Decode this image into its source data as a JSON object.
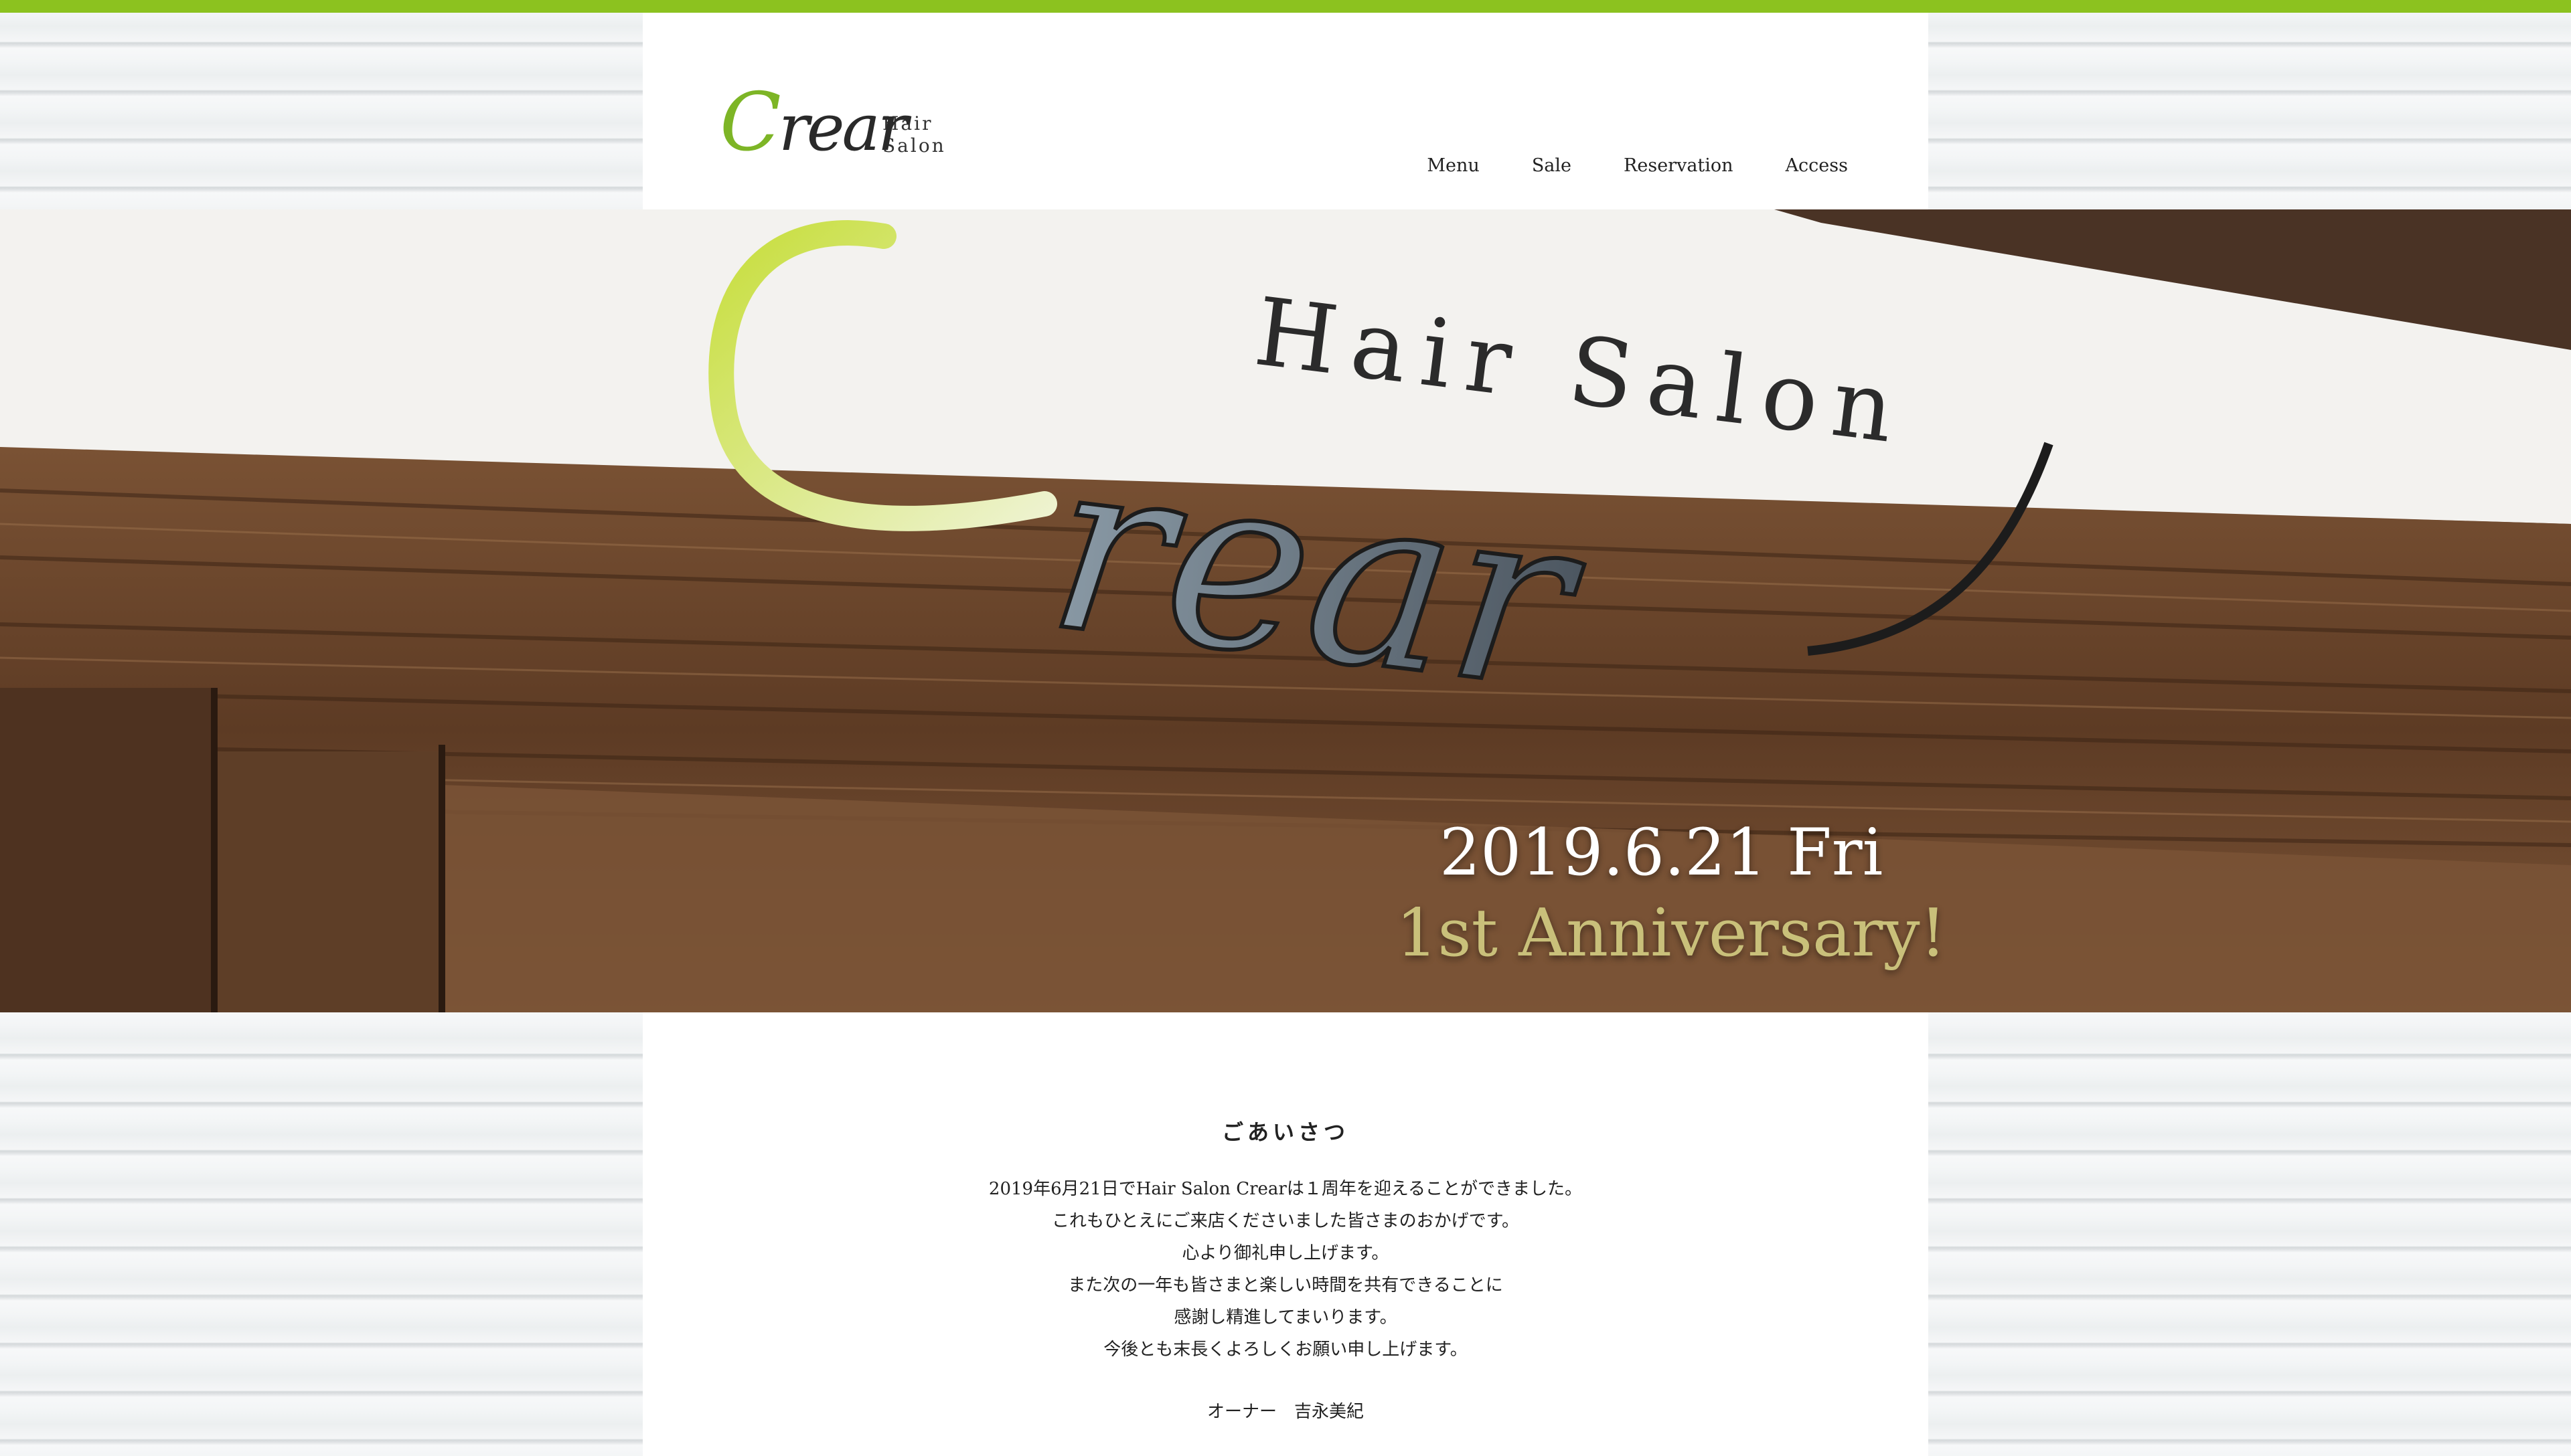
{
  "header": {
    "logo_small": "Hair Salon",
    "logo_first": "C",
    "logo_rest": "rear",
    "nav": [
      {
        "label": "Menu"
      },
      {
        "label": "Sale"
      },
      {
        "label": "Reservation"
      },
      {
        "label": "Access"
      }
    ]
  },
  "hero": {
    "sign_small": "Hair Salon",
    "sign_big": "Crear",
    "date": "2019.6.21 Fri",
    "anniversary": "1st Anniversary!"
  },
  "greeting": {
    "title": "ごあいさつ",
    "lines": [
      "2019年6月21日でHair Salon Crearは１周年を迎えることができました。",
      "これもひとえにご来店くださいました皆さまのおかげです。",
      "心より御礼申し上げます。",
      "また次の一年も皆さまと楽しい時間を共有できることに",
      "感謝し精進してまいります。",
      "今後とも末長くよろしくお願い申し上げます。"
    ],
    "owner": "オーナー　吉永美紀"
  },
  "colors": {
    "accent_green": "#8cc21f",
    "anniversary_gold": "#c9c07a"
  }
}
